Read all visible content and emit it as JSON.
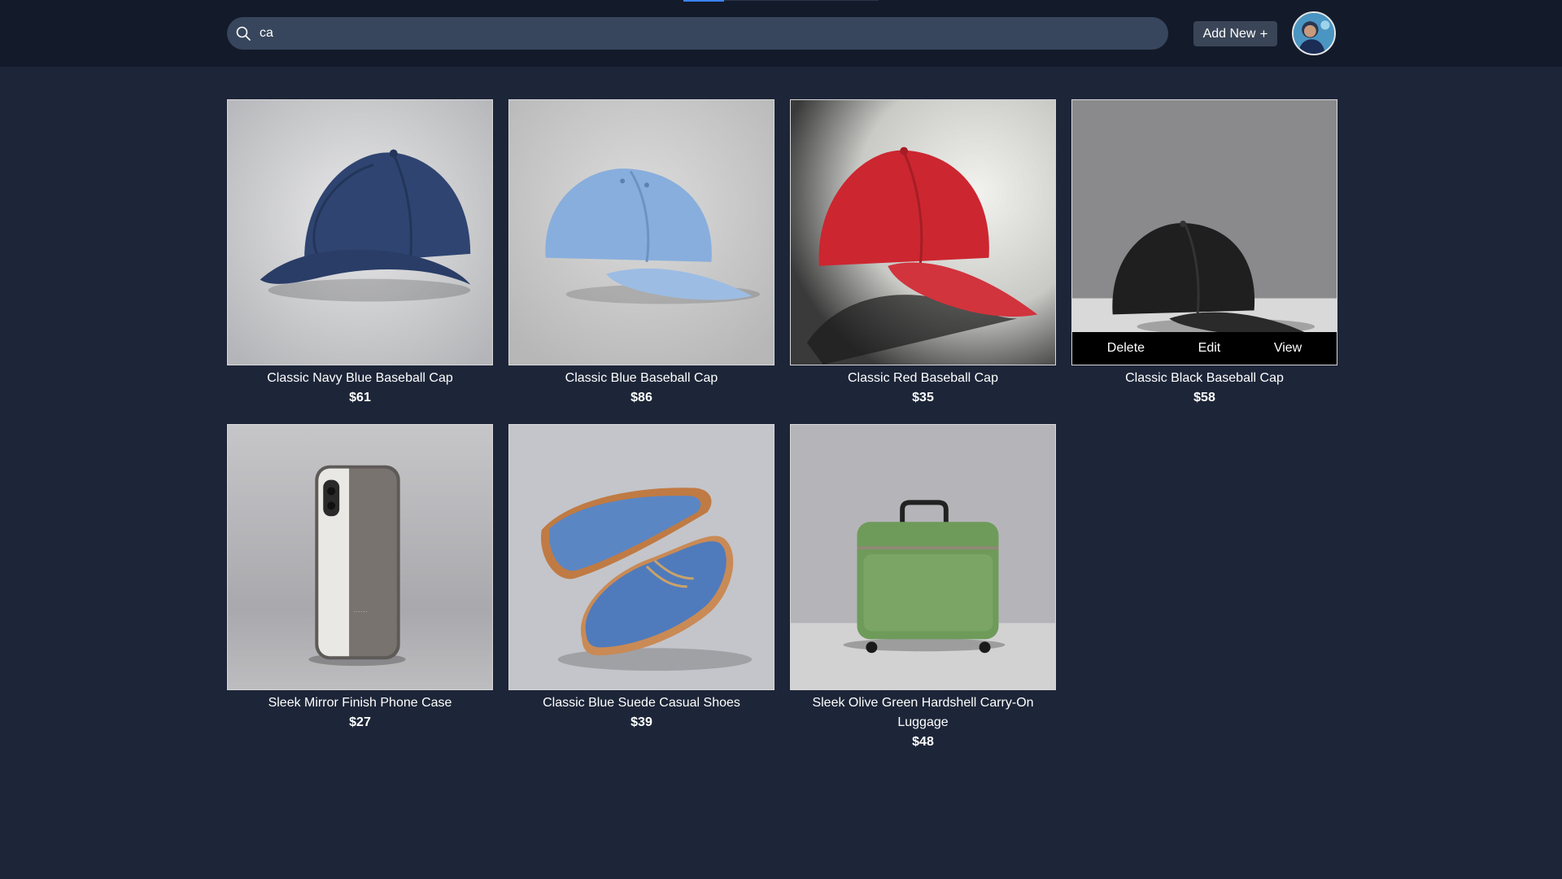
{
  "header": {
    "search_value": "ca",
    "add_new_label": "Add New",
    "add_new_icon": "+"
  },
  "products": [
    {
      "name": "Classic Navy Blue Baseball Cap",
      "price": "$61",
      "color": "#2f4470",
      "kind": "cap"
    },
    {
      "name": "Classic Blue Baseball Cap",
      "price": "$86",
      "color": "#7fa7d6",
      "kind": "cap"
    },
    {
      "name": "Classic Red Baseball Cap",
      "price": "$35",
      "color": "#c8262e",
      "kind": "cap"
    },
    {
      "name": "Classic Black Baseball Cap",
      "price": "$58",
      "color": "#1e1e1e",
      "kind": "cap"
    },
    {
      "name": "Sleek Mirror Finish Phone Case",
      "price": "$27",
      "color": "#6e6866",
      "kind": "phone"
    },
    {
      "name": "Classic Blue Suede Casual Shoes",
      "price": "$39",
      "color": "#4f7bbd",
      "kind": "shoes"
    },
    {
      "name": "Sleek Olive Green Hardshell Carry-On Luggage",
      "price": "$48",
      "color": "#6e9a5a",
      "kind": "luggage"
    }
  ],
  "card_actions": {
    "delete": "Delete",
    "edit": "Edit",
    "view": "View"
  }
}
